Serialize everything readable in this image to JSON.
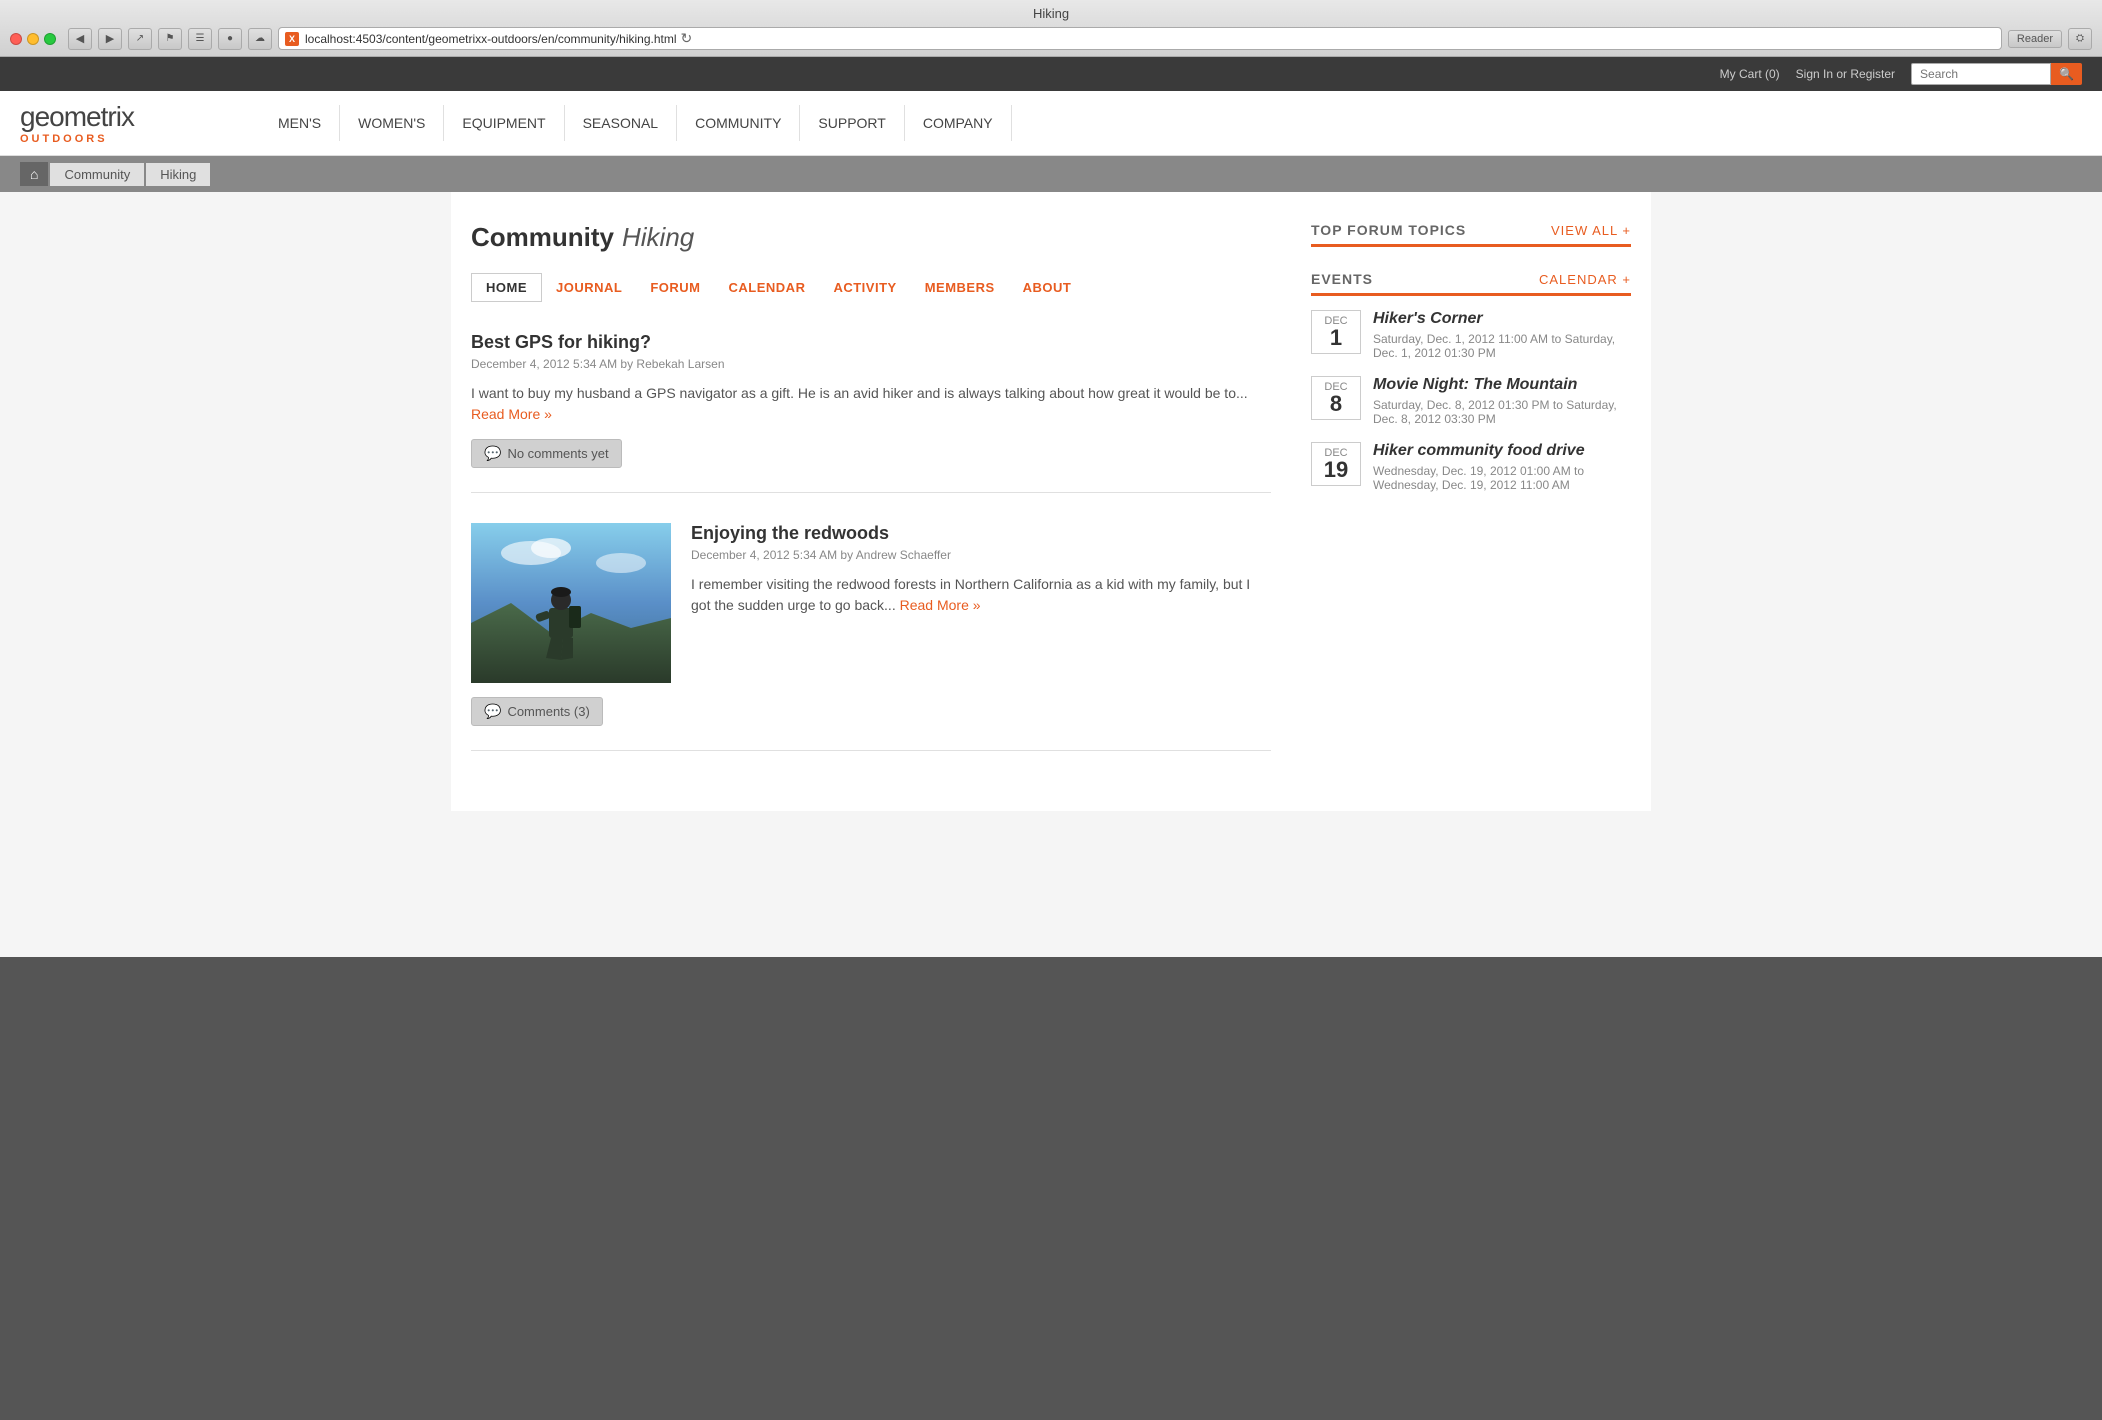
{
  "browser": {
    "title": "Hiking",
    "url_base": "localhost:4503",
    "url_path": "/content/geometrixx-outdoors/en/community/hiking.html"
  },
  "utility_bar": {
    "cart": "My Cart (0)",
    "signin": "Sign In or Register",
    "search_placeholder": "Search"
  },
  "logo": {
    "name": "geometrix",
    "sub": "OUTDOORS"
  },
  "main_nav": [
    {
      "label": "MEN'S"
    },
    {
      "label": "WOMEN'S"
    },
    {
      "label": "EQUIPMENT"
    },
    {
      "label": "SEASONAL"
    },
    {
      "label": "COMMUNITY"
    },
    {
      "label": "SUPPORT"
    },
    {
      "label": "COMPANY"
    }
  ],
  "breadcrumb": {
    "home_icon": "⌂",
    "items": [
      "Community",
      "Hiking"
    ]
  },
  "community": {
    "label": "Community",
    "name": "Hiking"
  },
  "sub_nav": [
    {
      "label": "HOME",
      "active": true
    },
    {
      "label": "JOURNAL"
    },
    {
      "label": "FORUM"
    },
    {
      "label": "CALENDAR"
    },
    {
      "label": "ACTIVITY"
    },
    {
      "label": "MEMBERS"
    },
    {
      "label": "ABOUT"
    }
  ],
  "posts": [
    {
      "title": "Best GPS for hiking?",
      "meta": "December 4, 2012 5:34 AM by Rebekah Larsen",
      "body": "I want to buy my husband a GPS navigator as a gift. He is an avid hiker and is always talking about how great it would be to...",
      "read_more": "Read More »",
      "comments": "No comments yet",
      "has_image": false
    },
    {
      "title": "Enjoying the redwoods",
      "meta": "December 4, 2012 5:34 AM by Andrew Schaeffer",
      "body": "I remember visiting the redwood forests in Northern California as a kid with my family, but I got the sudden urge to go back...",
      "read_more": "Read More »",
      "comments": "Comments (3)",
      "has_image": true
    }
  ],
  "sidebar": {
    "forum": {
      "title": "TOP FORUM TOPICS",
      "view_all": "view all +"
    },
    "events": {
      "title": "EVENTS",
      "calendar_link": "calendar +",
      "items": [
        {
          "month": "Dec",
          "day": "1",
          "title": "Hiker's Corner",
          "time": "Saturday, Dec. 1, 2012 11:00 AM to Saturday, Dec. 1, 2012 01:30 PM"
        },
        {
          "month": "Dec",
          "day": "8",
          "title": "Movie Night: The Mountain",
          "time": "Saturday, Dec. 8, 2012 01:30 PM to Saturday, Dec. 8, 2012 03:30 PM"
        },
        {
          "month": "Dec",
          "day": "19",
          "title": "Hiker community food drive",
          "time": "Wednesday, Dec. 19, 2012 01:00 AM to Wednesday, Dec. 19, 2012 11:00 AM"
        }
      ]
    }
  }
}
